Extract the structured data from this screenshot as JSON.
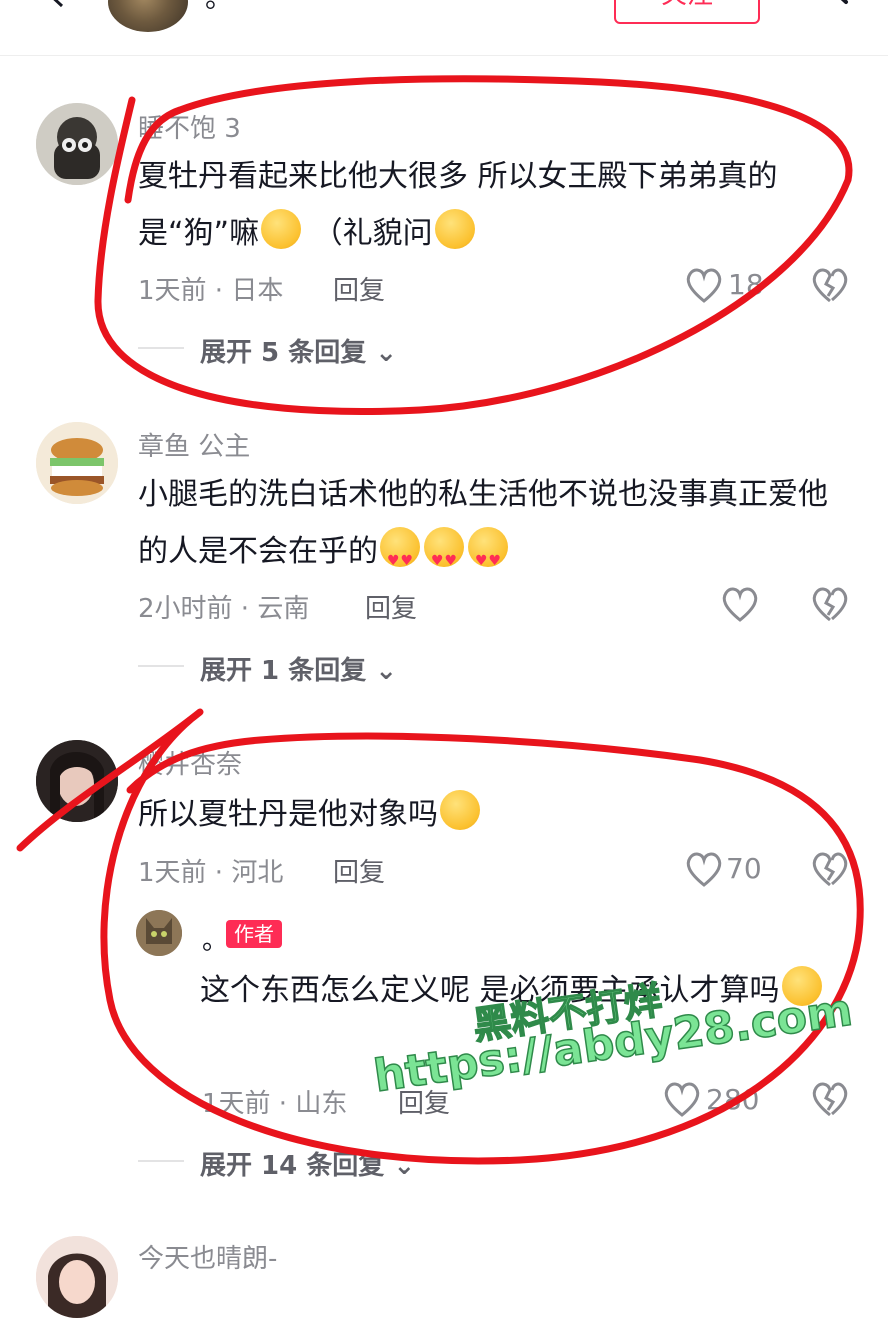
{
  "header": {
    "name": "。",
    "follow_label": "关注"
  },
  "comments": [
    {
      "username": "睡不饱 3",
      "text": "夏牡丹看起来比他大很多 所以女王殿下弟弟真的是“狗”嘛",
      "text_tail": "（礼貌问",
      "time_location": "1天前 · 日本",
      "reply_label": "回复",
      "likes": "18",
      "expand_label": "展开 5 条回复"
    },
    {
      "username": "章鱼 公主",
      "text": "小腿毛的洗白话术他的私生活他不说也没事真正爱他的人是不会在乎的",
      "time_location": "2小时前 · 云南",
      "reply_label": "回复",
      "likes": "",
      "expand_label": "展开 1 条回复"
    },
    {
      "username": "樱井杏奈",
      "text": "所以夏牡丹是他对象吗",
      "time_location": "1天前 · 河北",
      "reply_label": "回复",
      "likes": "70",
      "reply": {
        "username": "。",
        "badge": "作者",
        "text": "这个东西怎么定义呢 是必须要主承认才算吗",
        "time_location": "1天前 · 山东",
        "reply_label": "回复",
        "likes": "280"
      },
      "expand_label": "展开 14 条回复"
    },
    {
      "username": "今天也晴朗-"
    }
  ],
  "watermark": {
    "line1": "黑料不打烊",
    "line2": "https://abdy28.com"
  },
  "colors": {
    "accent": "#fe2c55",
    "annotation": "#e8141c",
    "watermark": "#7be495"
  }
}
